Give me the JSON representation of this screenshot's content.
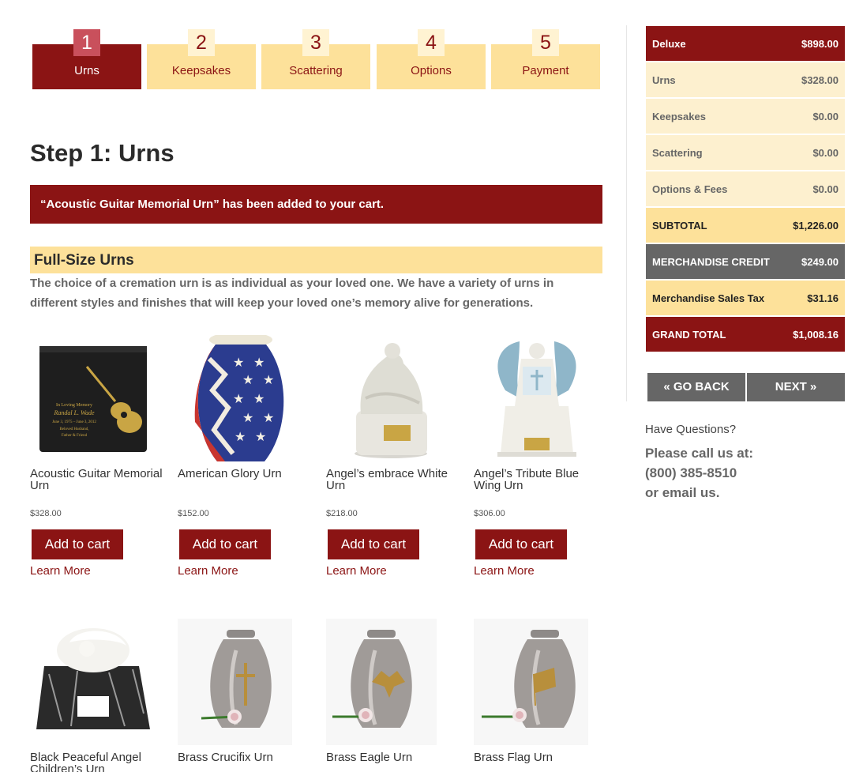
{
  "steps": [
    {
      "num": "1",
      "label": "Urns"
    },
    {
      "num": "2",
      "label": "Keepsakes"
    },
    {
      "num": "3",
      "label": "Scattering"
    },
    {
      "num": "4",
      "label": "Options"
    },
    {
      "num": "5",
      "label": "Payment"
    }
  ],
  "page_title": "Step 1: Urns",
  "cart_notice": "“Acoustic Guitar Memorial Urn” has been added to your cart.",
  "section": {
    "heading": "Full-Size Urns",
    "description": "The choice of a cremation urn is as individual as your loved one.  We have a variety of urns in different styles and finishes that will keep your loved one’s memory alive for generations."
  },
  "products": [
    {
      "name": "Acoustic Guitar Memorial Urn",
      "price": "$328.00",
      "button": "Add to cart",
      "link": "Learn More"
    },
    {
      "name": "American Glory Urn",
      "price": "$152.00",
      "button": "Add to cart",
      "link": "Learn More"
    },
    {
      "name": "Angel’s embrace White Urn",
      "price": "$218.00",
      "button": "Add to cart",
      "link": "Learn More"
    },
    {
      "name": "Angel’s Tribute Blue Wing Urn",
      "price": "$306.00",
      "button": "Add to cart",
      "link": "Learn More"
    },
    {
      "name": "Black Peaceful Angel Children’s Urn"
    },
    {
      "name": "Brass Crucifix Urn"
    },
    {
      "name": "Brass Eagle Urn"
    },
    {
      "name": "Brass Flag Urn"
    }
  ],
  "engraving": {
    "line1": "In Loving Memory",
    "line2": "Randal L. Wade",
    "line3": "June 3, 1975 – June 3, 2012",
    "line4": "Beloved Husband,",
    "line5": "Father & Friend"
  },
  "summary": {
    "package": {
      "label": "Deluxe",
      "value": "$898.00"
    },
    "urns": {
      "label": "Urns",
      "value": "$328.00"
    },
    "keepsakes": {
      "label": "Keepsakes",
      "value": "$0.00"
    },
    "scattering": {
      "label": "Scattering",
      "value": "$0.00"
    },
    "options": {
      "label": "Options & Fees",
      "value": "$0.00"
    },
    "subtotal": {
      "label": "SUBTOTAL",
      "value": "$1,226.00"
    },
    "credit": {
      "label": "MERCHANDISE CREDIT",
      "value": "$249.00"
    },
    "tax": {
      "label": "Merchandise Sales Tax",
      "value": "$31.16"
    },
    "grand_total": {
      "label": "GRAND TOTAL",
      "value": "$1,008.16"
    }
  },
  "nav": {
    "back": "« GO BACK",
    "next": "NEXT »"
  },
  "contact": {
    "question": "Have Questions?",
    "line1": "Please call us at:",
    "phone": "(800) 385-8510",
    "line3": "or email us."
  },
  "colors": {
    "brand_red": "#8b1414",
    "cream": "#fde19a",
    "light_cream": "#fdf0cf",
    "grey": "#666666",
    "active_step_badge": "#c9505c"
  }
}
